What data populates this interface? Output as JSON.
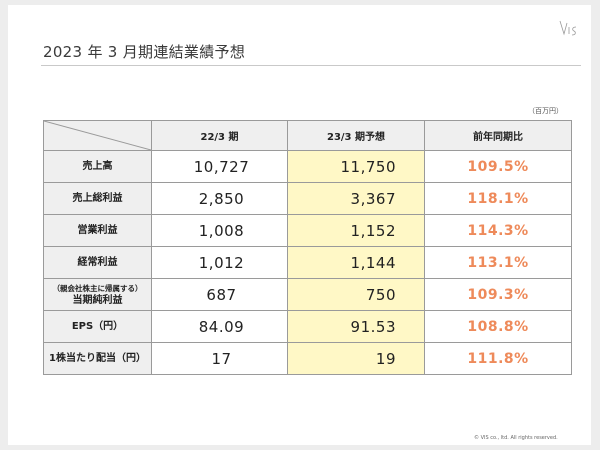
{
  "slide": {
    "title": "2023 年 3 月期連結業績予想",
    "unit": "（百万円）",
    "copyright": "© VIS co., ltd. All rights reserved."
  },
  "table": {
    "headers": [
      "22/3 期",
      "23/3 期予想",
      "前年同期比"
    ],
    "rows": [
      {
        "label": "売上高",
        "sublabel": "",
        "fy22": "10,727",
        "fy23": "11,750",
        "ratio": "109.5%"
      },
      {
        "label": "売上総利益",
        "sublabel": "",
        "fy22": "2,850",
        "fy23": "3,367",
        "ratio": "118.1%"
      },
      {
        "label": "営業利益",
        "sublabel": "",
        "fy22": "1,008",
        "fy23": "1,152",
        "ratio": "114.3%"
      },
      {
        "label": "経常利益",
        "sublabel": "",
        "fy22": "1,012",
        "fy23": "1,144",
        "ratio": "113.1%"
      },
      {
        "label": "当期純利益",
        "sublabel": "（親会社株主に帰属する）",
        "fy22": "687",
        "fy23": "750",
        "ratio": "109.3%"
      },
      {
        "label": "EPS（円）",
        "sublabel": "",
        "fy22": "84.09",
        "fy23": "91.53",
        "ratio": "108.8%"
      },
      {
        "label": "1株当たり配当（円）",
        "sublabel": "",
        "fy22": "17",
        "fy23": "19",
        "ratio": "111.8%"
      }
    ]
  },
  "colors": {
    "forecast_highlight": "#fff8c6",
    "ratio_text": "#ee8a5a"
  },
  "icons": {
    "logo": "vis-logo"
  }
}
